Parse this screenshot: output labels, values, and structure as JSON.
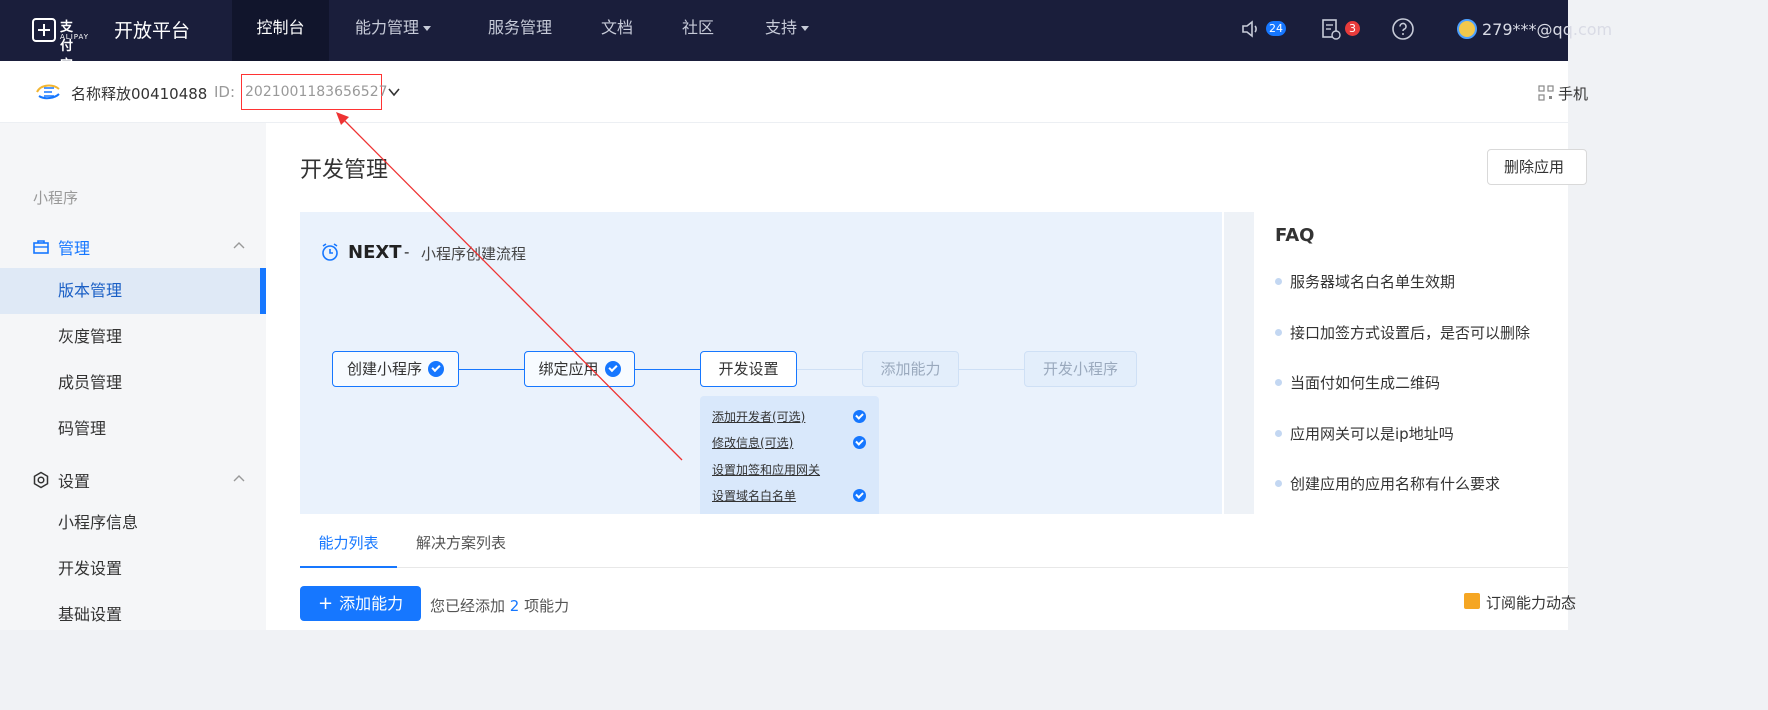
{
  "topbar": {
    "brand_cn": "支付宝",
    "brand_en": "ALIPAY",
    "platform": "开放平台",
    "nav": [
      {
        "label": "控制台"
      },
      {
        "label": "能力管理"
      },
      {
        "label": "服务管理"
      },
      {
        "label": "文档"
      },
      {
        "label": "社区"
      },
      {
        "label": "支持"
      }
    ],
    "notify_count": "24",
    "task_count": "3",
    "user": "279***@qq.com"
  },
  "app": {
    "name": "名称释放00410488",
    "id_label": "ID:",
    "id": "2021001183656527",
    "qr_label": "手机"
  },
  "sidebar": {
    "category": "小程序",
    "groups": [
      {
        "label": "管理"
      },
      {
        "label": "设置"
      }
    ],
    "items": [
      {
        "label": "版本管理"
      },
      {
        "label": "灰度管理"
      },
      {
        "label": "成员管理"
      },
      {
        "label": "码管理"
      },
      {
        "label": "小程序信息"
      },
      {
        "label": "开发设置"
      },
      {
        "label": "基础设置"
      }
    ]
  },
  "main": {
    "title": "开发管理",
    "delete_button": "删除应用",
    "flow": {
      "title": "NEXT",
      "separator": "-",
      "subtitle": "小程序创建流程",
      "steps": [
        {
          "label": "创建小程序",
          "status": "done"
        },
        {
          "label": "绑定应用",
          "status": "done"
        },
        {
          "label": "开发设置",
          "status": "current"
        },
        {
          "label": "添加能力",
          "status": "todo"
        },
        {
          "label": "开发小程序",
          "status": "todo"
        }
      ],
      "substeps": [
        {
          "label": "添加开发者(可选)",
          "done": true
        },
        {
          "label": "修改信息(可选)",
          "done": true
        },
        {
          "label": "设置加签和应用网关",
          "done": false
        },
        {
          "label": "设置域名白名单",
          "done": true
        }
      ]
    },
    "faq": {
      "title": "FAQ",
      "items": [
        "服务器域名白名单生效期",
        "接口加签方式设置后，是否可以删除",
        "当面付如何生成二维码",
        "应用网关可以是ip地址吗",
        "创建应用的应用名称有什么要求"
      ]
    },
    "tabs": [
      {
        "label": "能力列表"
      },
      {
        "label": "解决方案列表"
      }
    ],
    "add_button": "添加能力",
    "added_prefix": "您已经添加",
    "added_count": "2",
    "added_suffix": "项能力",
    "subscribe": "订阅能力动态"
  },
  "colors": {
    "topbar_bg": "#1a1e3b",
    "accent": "#1677ff",
    "annotation": "#ee3333"
  }
}
